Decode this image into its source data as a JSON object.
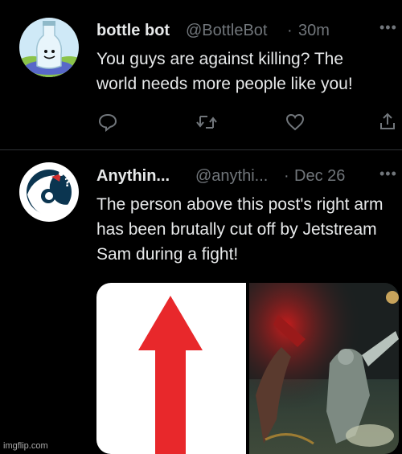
{
  "tweets": [
    {
      "name": "bottle bot",
      "handle": "@BottleBot",
      "sep": "·",
      "time": "30m",
      "text": "You guys are against killing? The world needs more people like you!",
      "more_icon": "more-dots-icon"
    },
    {
      "name": "Anythin...",
      "handle": "@anythi...",
      "sep": "·",
      "time": "Dec 26",
      "text": "The person above this post's right arm has been brutally cut off by Jetstream Sam during a fight!",
      "more_icon": "more-dots-icon"
    }
  ],
  "actions": [
    "reply-icon",
    "retweet-icon",
    "like-icon",
    "share-icon"
  ],
  "media": {
    "left_image": "red-up-arrow-image",
    "right_image": "jetstream-sam-fight-scene"
  },
  "watermark": "imgflip.com",
  "colors": {
    "background": "#000000",
    "text": "#e7e9ea",
    "muted": "#71767b",
    "arrow_red": "#e8282b"
  }
}
